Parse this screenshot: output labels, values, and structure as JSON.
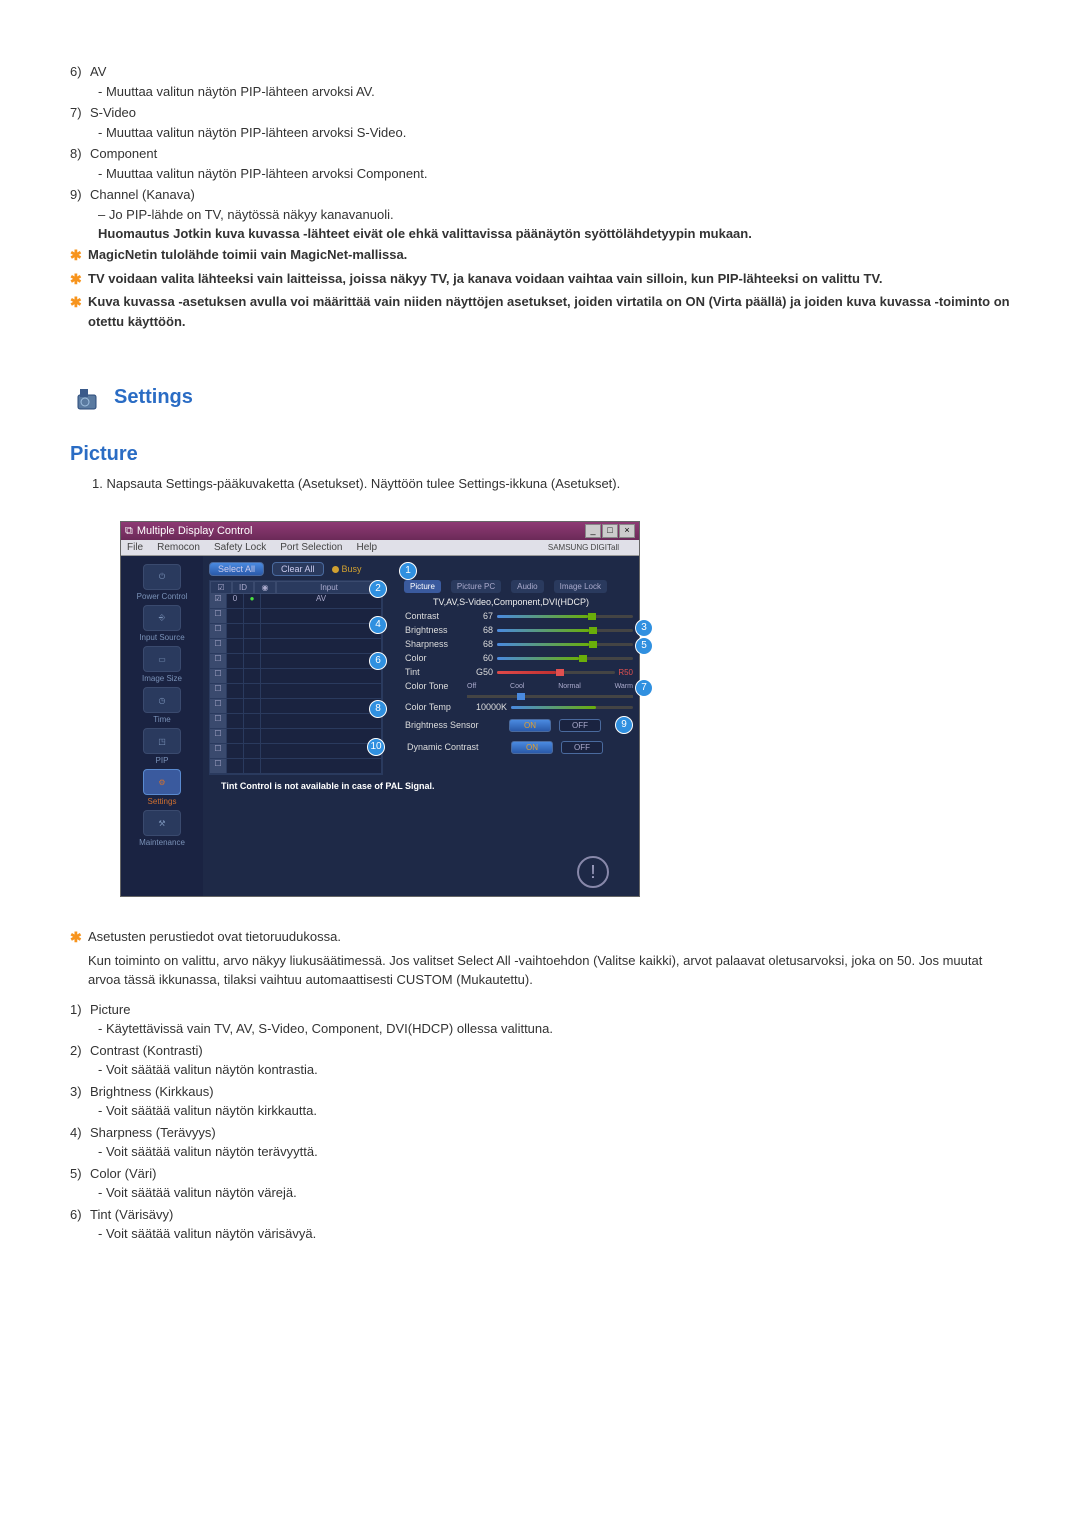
{
  "top_list": [
    {
      "num": "6)",
      "title": "AV",
      "desc": "- Muuttaa valitun näytön PIP-lähteen arvoksi AV."
    },
    {
      "num": "7)",
      "title": "S-Video",
      "desc": "- Muuttaa valitun näytön PIP-lähteen arvoksi S-Video."
    },
    {
      "num": "8)",
      "title": "Component",
      "desc": "- Muuttaa valitun näytön PIP-lähteen arvoksi Component."
    },
    {
      "num": "9)",
      "title": "Channel (Kanava)",
      "desc": "– Jo PIP-lähde on TV, näytössä näkyy kanavanuoli."
    }
  ],
  "note_bold": "Huomautus Jotkin kuva kuvassa -lähteet eivät ole ehkä valittavissa päänäytön syöttölähdetyypin mukaan.",
  "star_notes": [
    "MagicNetin tulolähde toimii vain MagicNet-mallissa.",
    "TV voidaan valita lähteeksi vain laitteissa, joissa näkyy TV, ja kanava voidaan vaihtaa vain silloin, kun PIP-lähteeksi on valittu TV.",
    "Kuva kuvassa -asetuksen avulla voi määrittää vain niiden näyttöjen asetukset, joiden virtatila on ON (Virta päällä) ja joiden kuva kuvassa -toiminto on otettu käyttöön."
  ],
  "settings_title": "Settings",
  "picture_title": "Picture",
  "step1": "1. Napsauta Settings-pääkuvaketta (Asetukset). Näyttöön tulee Settings-ikkuna (Asetukset).",
  "window": {
    "title": "Multiple Display Control",
    "menus": [
      "File",
      "Remocon",
      "Safety Lock",
      "Port Selection",
      "Help"
    ],
    "brand": "SAMSUNG DIGITall",
    "sidebar": [
      "Power Control",
      "Input Source",
      "Image Size",
      "Time",
      "PIP",
      "Settings",
      "Maintenance"
    ],
    "select_all": "Select All",
    "clear_all": "Clear All",
    "busy": "Busy",
    "id_headers": {
      "c1": "",
      "c2": "ID",
      "c3": "",
      "c4": "Input"
    },
    "row_input": "AV",
    "tabs": [
      "Picture",
      "Picture PC",
      "Audio",
      "Image Lock"
    ],
    "source_label": "TV,AV,S-Video,Component,DVI(HDCP)",
    "sliders": {
      "contrast": {
        "label": "Contrast",
        "val": "67"
      },
      "brightness": {
        "label": "Brightness",
        "val": "68"
      },
      "sharpness": {
        "label": "Sharpness",
        "val": "68"
      },
      "color": {
        "label": "Color",
        "val": "60"
      },
      "tint": {
        "label": "Tint",
        "val": "G50",
        "right": "R50"
      }
    },
    "color_tone": {
      "label": "Color Tone",
      "marks": [
        "Off",
        "Cool",
        "Normal",
        "Warm"
      ]
    },
    "color_temp": {
      "label": "Color Temp",
      "val": "10000K"
    },
    "brightness_sensor": {
      "label": "Brightness Sensor",
      "on": "ON",
      "off": "OFF"
    },
    "dynamic_contrast": {
      "label": "Dynamic Contrast",
      "on": "ON",
      "off": "OFF"
    },
    "footer": "Tint Control is not available in case of PAL Signal."
  },
  "info_star": "Asetusten perustiedot ovat tietoruudukossa.",
  "info_para": "Kun toiminto on valittu, arvo näkyy liukusäätimessä. Jos valitset Select All -vaihtoehdon (Valitse kaikki), arvot palaavat oletusarvoksi, joka on 50. Jos muutat arvoa tässä ikkunassa, tilaksi vaihtuu automaattisesti CUSTOM (Mukautettu).",
  "bottom_list": [
    {
      "num": "1)",
      "title": "Picture",
      "desc": "- Käytettävissä vain TV, AV, S-Video, Component, DVI(HDCP) ollessa valittuna."
    },
    {
      "num": "2)",
      "title": "Contrast (Kontrasti)",
      "desc": "- Voit säätää valitun näytön kontrastia."
    },
    {
      "num": "3)",
      "title": "Brightness (Kirkkaus)",
      "desc": "- Voit säätää valitun näytön kirkkautta."
    },
    {
      "num": "4)",
      "title": "Sharpness (Terävyys)",
      "desc": "- Voit säätää valitun näytön terävyyttä."
    },
    {
      "num": "5)",
      "title": "Color (Väri)",
      "desc": "- Voit säätää valitun näytön värejä."
    },
    {
      "num": "6)",
      "title": "Tint (Värisävy)",
      "desc": "- Voit säätää valitun näytön värisävyä."
    }
  ]
}
